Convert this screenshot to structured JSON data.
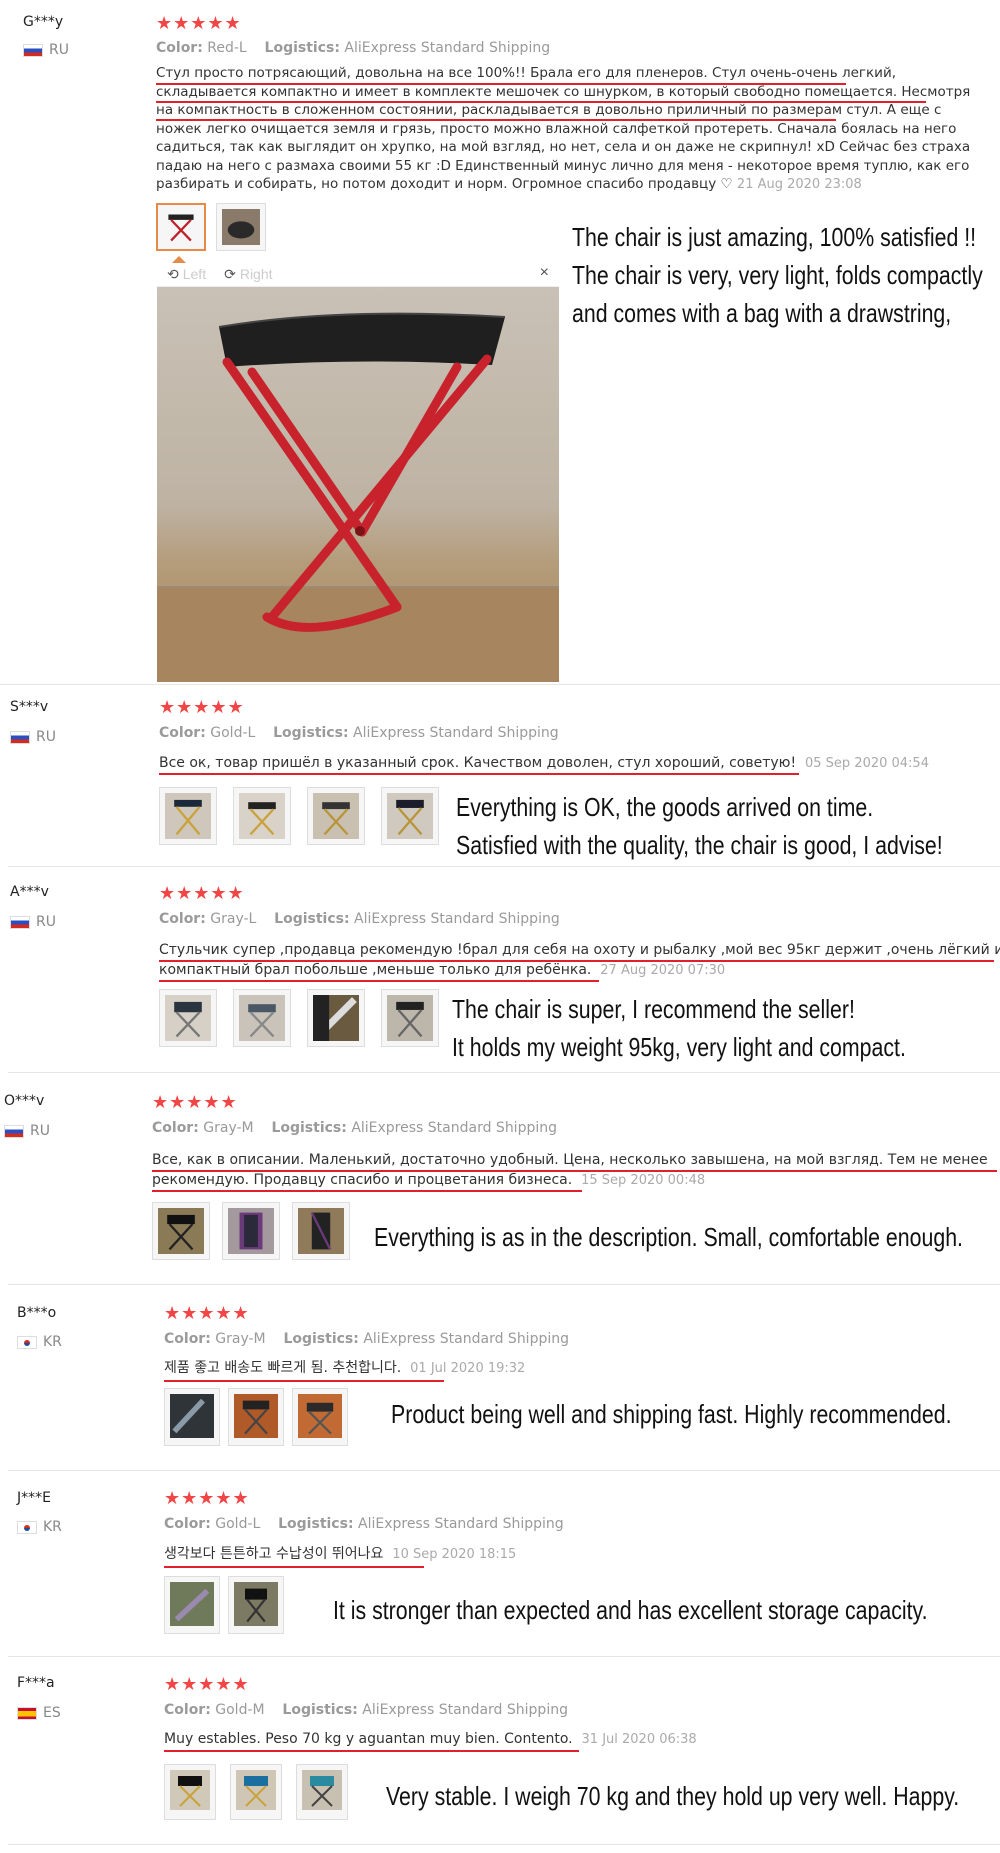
{
  "reviews": [
    {
      "user": "G***y",
      "country": "RU",
      "flag": "ru",
      "stars": "★★★★★",
      "color_label": "Color:",
      "color": "Red-L",
      "logistics_label": "Logistics:",
      "logistics": "AliExpress Standard Shipping",
      "lines": [
        "Стул просто потрясающий, довольна на все 100%!! Брала его для пленеров. Стул очень-очень легкий,",
        "складывается компактно и имеет в комплекте мешочек со шнурком, в который свободно помещается. Несмотря",
        "на компактность в сложенном состоянии, раскладывается в довольно приличный по размерам стул. А еще с",
        "ножек легко очищается земля и грязь, просто можно влажной салфеткой протереть. Сначала боялась на него",
        "садиться, так как выглядит он хрупко, на мой взгляд, но нет, села и он даже не скрипнул! xD Сейчас без страха",
        "падаю на него с размаха своими 55 кг :D Единственный минус лично для меня - некоторое время туплю, как его",
        "разбирать и собирать, но потом доходит и норм. Огромное спасибо продавцу ♡"
      ],
      "date": "21 Aug 2020 23:08",
      "caption": [
        "The chair is just amazing, 100% satisfied !!",
        "The chair is very, very light, folds compactly",
        "and comes with a bag with a drawstring,"
      ],
      "viewer": {
        "left_label": "Left",
        "right_label": "Right",
        "close": "×"
      }
    },
    {
      "user": "S***v",
      "country": "RU",
      "flag": "ru",
      "stars": "★★★★★",
      "color_label": "Color:",
      "color": "Gold-L",
      "logistics_label": "Logistics:",
      "logistics": "AliExpress Standard Shipping",
      "lines": [
        "Все ок, товар пришёл в указанный срок. Качеством доволен, стул хороший, советую!"
      ],
      "date": "05 Sep 2020 04:54",
      "caption": [
        "Everything is OK, the goods arrived on time.",
        "Satisfied with the quality, the chair is good, I advise!"
      ]
    },
    {
      "user": "A***v",
      "country": "RU",
      "flag": "ru",
      "stars": "★★★★★",
      "color_label": "Color:",
      "color": "Gray-L",
      "logistics_label": "Logistics:",
      "logistics": "AliExpress Standard Shipping",
      "lines": [
        "Стульчик супер ,продавца рекомендую !брал для себя на охоту и рыбалку ,мой вес 95кг держит ,очень лёгкий и",
        "компактный брал побольше ,меньше только для ребёнка."
      ],
      "date": "27 Aug 2020 07:30",
      "caption": [
        "The chair is super, I recommend the seller!",
        "It holds my weight 95kg, very light and compact."
      ]
    },
    {
      "user": "O***v",
      "country": "RU",
      "flag": "ru",
      "stars": "★★★★★",
      "color_label": "Color:",
      "color": "Gray-M",
      "logistics_label": "Logistics:",
      "logistics": "AliExpress Standard Shipping",
      "lines": [
        "Все, как в описании. Маленький, достаточно удобный. Цена, несколько завышена, на мой взгляд. Тем не менее",
        "рекомендую. Продавцу спасибо и процветания бизнеса."
      ],
      "date": "15 Sep 2020 00:48",
      "caption": [
        "Everything is as in the description. Small, comfortable enough."
      ]
    },
    {
      "user": "B***o",
      "country": "KR",
      "flag": "kr",
      "stars": "★★★★★",
      "color_label": "Color:",
      "color": "Gray-M",
      "logistics_label": "Logistics:",
      "logistics": "AliExpress Standard Shipping",
      "lines": [
        "제품 좋고 배송도 빠르게 됨. 추천합니다."
      ],
      "date": "01 Jul 2020 19:32",
      "caption": [
        "Product being well and shipping fast. Highly recommended."
      ]
    },
    {
      "user": "J***E",
      "country": "KR",
      "flag": "kr",
      "stars": "★★★★★",
      "color_label": "Color:",
      "color": "Gold-L",
      "logistics_label": "Logistics:",
      "logistics": "AliExpress Standard Shipping",
      "lines": [
        "생각보다 튼튼하고 수납성이 뛰어나요"
      ],
      "date": "10 Sep 2020 18:15",
      "caption": [
        "It is stronger than expected and has excellent storage capacity."
      ]
    },
    {
      "user": "F***a",
      "country": "ES",
      "flag": "es",
      "stars": "★★★★★",
      "color_label": "Color:",
      "color": "Gold-M",
      "logistics_label": "Logistics:",
      "logistics": "AliExpress Standard Shipping",
      "lines": [
        "Muy estables. Peso 70 kg y aguantan muy bien. Contento."
      ],
      "date": "31 Jul 2020 06:38",
      "caption": [
        "Very stable. I weigh 70 kg and they hold up very well. Happy."
      ]
    }
  ],
  "colors": {
    "star": "#f24545",
    "underline": "#e0202a",
    "meta": "#9a9a9a",
    "accent_thumb": "#e58b4a"
  }
}
